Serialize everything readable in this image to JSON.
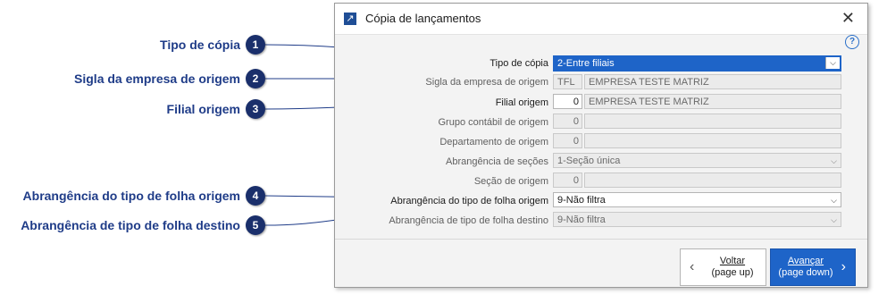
{
  "callouts": [
    {
      "label": "Tipo de cópia",
      "num": "1"
    },
    {
      "label": "Sigla da empresa de origem",
      "num": "2"
    },
    {
      "label": "Filial origem",
      "num": "3"
    },
    {
      "label": "Abrangência do tipo de folha origem",
      "num": "4"
    },
    {
      "label": "Abrangência de tipo de folha destino",
      "num": "5"
    }
  ],
  "dialog": {
    "title": "Cópia de lançamentos",
    "help": "?",
    "fields": {
      "tipo_copia": {
        "label": "Tipo de cópia",
        "value": "2-Entre filiais"
      },
      "sigla_empresa": {
        "label": "Sigla da empresa de origem",
        "code": "TFL",
        "name": "EMPRESA TESTE MATRIZ"
      },
      "filial_origem": {
        "label": "Filial origem",
        "code": "0",
        "name": "EMPRESA TESTE MATRIZ"
      },
      "grupo_contabil": {
        "label": "Grupo contábil de origem",
        "code": "0",
        "name": ""
      },
      "departamento": {
        "label": "Departamento de origem",
        "code": "0",
        "name": ""
      },
      "abrangencia_secoes": {
        "label": "Abrangência de seções",
        "value": "1-Seção única"
      },
      "secao_origem": {
        "label": "Seção de origem",
        "code": "0",
        "name": ""
      },
      "abr_folha_origem": {
        "label": "Abrangência do tipo de folha origem",
        "value": "9-Não filtra"
      },
      "abr_folha_destino": {
        "label": "Abrangência de tipo de folha destino",
        "value": "9-Não filtra"
      }
    },
    "buttons": {
      "back_line1": "Voltar",
      "back_line2": "(page up)",
      "next_line1": "Avançar",
      "next_line2": "(page down)"
    }
  },
  "colors": {
    "accent": "#1e64c8",
    "callout_text": "#1f3c88",
    "badge": "#1a2f6b"
  }
}
